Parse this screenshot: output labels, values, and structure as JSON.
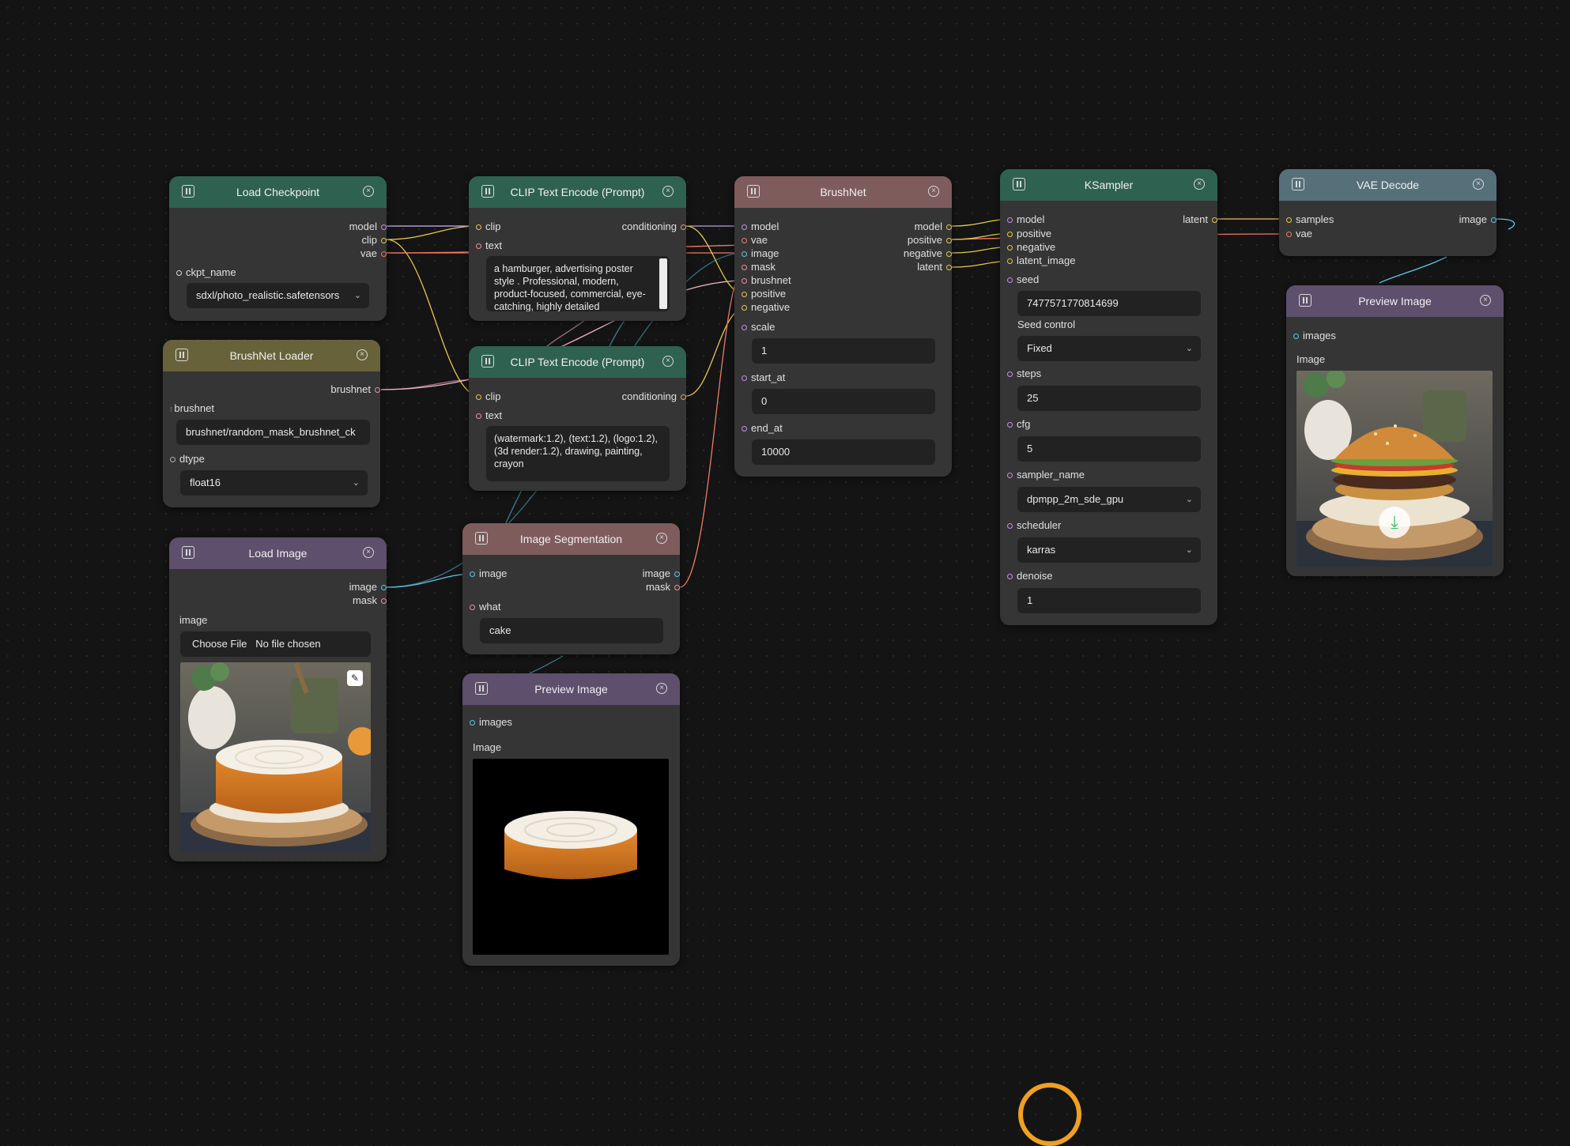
{
  "nodes": {
    "load_checkpoint": {
      "title": "Load Checkpoint",
      "outputs": [
        "model",
        "clip",
        "vae"
      ],
      "ckpt_label": "ckpt_name",
      "ckpt_value": "sdxl/photo_realistic.safetensors"
    },
    "brushnet_loader": {
      "title": "BrushNet Loader",
      "outputs": [
        "brushnet"
      ],
      "brushnet_label": "brushnet",
      "brushnet_value": "brushnet/random_mask_brushnet_ck",
      "dtype_label": "dtype",
      "dtype_value": "float16"
    },
    "load_image": {
      "title": "Load Image",
      "outputs": [
        "image",
        "mask"
      ],
      "image_label": "image",
      "file_button": "Choose File",
      "file_status": "No file chosen",
      "edit_icon": "pencil-icon"
    },
    "clip_pos": {
      "title": "CLIP Text Encode (Prompt)",
      "inputs": [
        "clip",
        "text"
      ],
      "outputs": [
        "conditioning"
      ],
      "text": "a hamburger, advertising poster style . Professional, modern, product-focused, commercial, eye-catching, highly detailed"
    },
    "clip_neg": {
      "title": "CLIP Text Encode (Prompt)",
      "inputs": [
        "clip",
        "text"
      ],
      "outputs": [
        "conditioning"
      ],
      "text": "(watermark:1.2), (text:1.2), (logo:1.2), (3d render:1.2), drawing, painting, crayon"
    },
    "image_seg": {
      "title": "Image Segmentation",
      "inputs": [
        "image",
        "what"
      ],
      "outputs": [
        "image",
        "mask"
      ],
      "what_value": "cake"
    },
    "preview_mid": {
      "title": "Preview Image",
      "inputs": [
        "images"
      ],
      "image_label": "Image"
    },
    "brushnet": {
      "title": "BrushNet",
      "inputs": [
        "model",
        "vae",
        "image",
        "mask",
        "brushnet",
        "positive",
        "negative"
      ],
      "outputs": [
        "model",
        "positive",
        "negative",
        "latent"
      ],
      "scale_label": "scale",
      "scale_value": "1",
      "start_label": "start_at",
      "start_value": "0",
      "end_label": "end_at",
      "end_value": "10000"
    },
    "ksampler": {
      "title": "KSampler",
      "inputs": [
        "model",
        "positive",
        "negative",
        "latent_image"
      ],
      "outputs": [
        "latent"
      ],
      "seed_label": "seed",
      "seed_value": "7477571770814699",
      "seed_control_label": "Seed control",
      "seed_control_value": "Fixed",
      "steps_label": "steps",
      "steps_value": "25",
      "cfg_label": "cfg",
      "cfg_value": "5",
      "sampler_label": "sampler_name",
      "sampler_value": "dpmpp_2m_sde_gpu",
      "scheduler_label": "scheduler",
      "scheduler_value": "karras",
      "denoise_label": "denoise",
      "denoise_value": "1"
    },
    "vae_decode": {
      "title": "VAE Decode",
      "inputs": [
        "samples",
        "vae"
      ],
      "outputs": [
        "image"
      ]
    },
    "preview_right": {
      "title": "Preview Image",
      "inputs": [
        "images"
      ],
      "image_label": "Image",
      "download_icon": "download-icon"
    }
  },
  "colors": {
    "canvas": "#141414",
    "node_body": "#353535",
    "header_green": "#2f6150",
    "header_olive": "#67623a",
    "header_purple": "#5e4f6c",
    "header_brown": "#7e5c5c",
    "header_slate": "#56707a"
  }
}
